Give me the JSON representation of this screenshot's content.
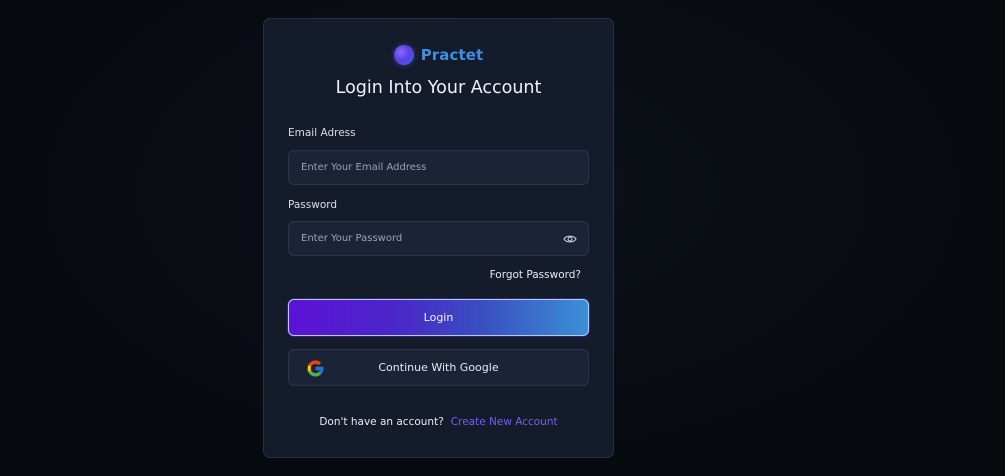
{
  "brand": {
    "name": "Practet"
  },
  "form": {
    "title": "Login Into Your Account",
    "email": {
      "label": "Email Adress",
      "placeholder": "Enter Your Email Address",
      "value": ""
    },
    "password": {
      "label": "Password",
      "placeholder": "Enter Your Password",
      "value": ""
    },
    "forgot_label": "Forgot Password?",
    "login_label": "Login",
    "google_label": "Continue With Google"
  },
  "footer": {
    "prompt": "Don't have an account?",
    "link_label": "Create New Account"
  },
  "icons": {
    "logo": "brand-logo-orb",
    "password_toggle": "eye-icon",
    "google": "google-g-icon"
  },
  "colors": {
    "background": "#080b11",
    "card": "#141b2a",
    "field": "#1b2436",
    "brand": "#3b8fe6",
    "link": "#7a5cf0",
    "button_gradient_start": "#5d12d6",
    "button_gradient_end": "#3b90d6"
  }
}
